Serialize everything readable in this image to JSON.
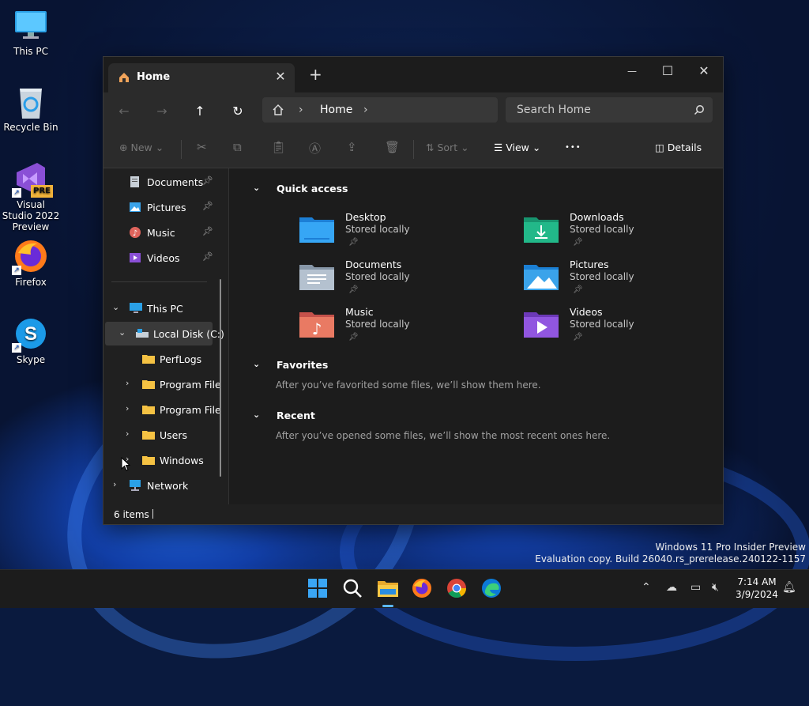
{
  "desktop": {
    "icons": [
      {
        "label": "This PC"
      },
      {
        "label": "Recycle Bin"
      },
      {
        "label": "Visual Studio 2022 Preview",
        "badge": "PRE"
      },
      {
        "label": "Firefox"
      },
      {
        "label": "Skype"
      }
    ],
    "watermark_line1": "Windows 11 Pro Insider Preview",
    "watermark_line2": "Evaluation copy. Build 26040.rs_prerelease.240122-1157"
  },
  "window": {
    "tab_title": "Home",
    "tab_close": "✕",
    "new_tab": "+",
    "minimize": "—",
    "maximize": "☐",
    "close": "✕"
  },
  "nav": {
    "back": "←",
    "forward": "→",
    "up": "↑",
    "refresh": "↻",
    "breadcrumb": "Home",
    "sep": "›",
    "search_placeholder": "Search Home"
  },
  "toolbar": {
    "new": "New",
    "sort": "Sort",
    "view": "View",
    "more": "•••",
    "details": "Details"
  },
  "sidebar": {
    "pinned": [
      {
        "label": "Documents"
      },
      {
        "label": "Pictures"
      },
      {
        "label": "Music"
      },
      {
        "label": "Videos"
      }
    ],
    "this_pc": "This PC",
    "local_disk": "Local Disk (C:)",
    "folders": [
      {
        "label": "PerfLogs"
      },
      {
        "label": "Program File"
      },
      {
        "label": "Program File"
      },
      {
        "label": "Users"
      },
      {
        "label": "Windows"
      }
    ],
    "network": "Network"
  },
  "content": {
    "quick_access": "Quick access",
    "items": [
      {
        "name": "Desktop",
        "sub": "Stored locally"
      },
      {
        "name": "Downloads",
        "sub": "Stored locally"
      },
      {
        "name": "Documents",
        "sub": "Stored locally"
      },
      {
        "name": "Pictures",
        "sub": "Stored locally"
      },
      {
        "name": "Music",
        "sub": "Stored locally"
      },
      {
        "name": "Videos",
        "sub": "Stored locally"
      }
    ],
    "favorites": "Favorites",
    "favorites_msg": "After you’ve favorited some files, we’ll show them here.",
    "recent": "Recent",
    "recent_msg": "After you’ve opened some files, we’ll show the most recent ones here."
  },
  "status": {
    "count": "6 items"
  },
  "taskbar": {
    "time": "7:14 AM",
    "date": "3/9/2024"
  },
  "colors": {
    "accent": "#0a84ff",
    "folder_yellow": "#f5c243",
    "window_bg": "#202020"
  }
}
